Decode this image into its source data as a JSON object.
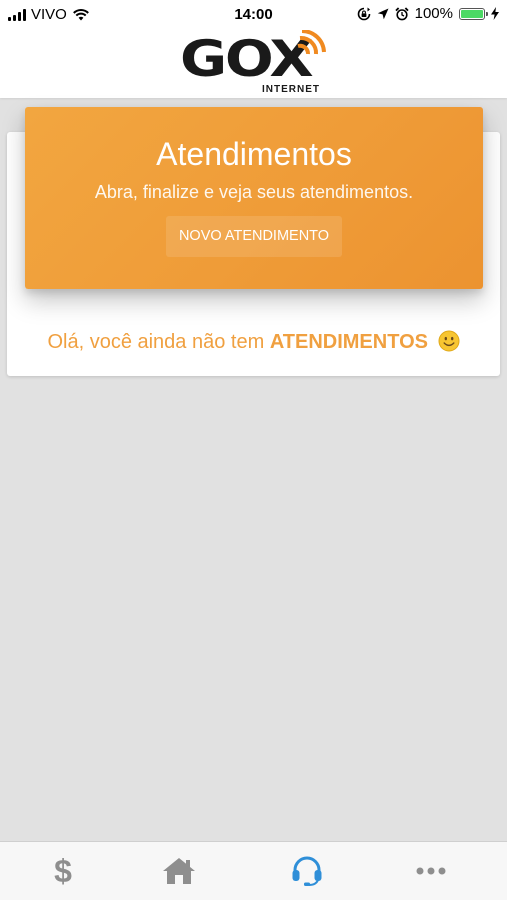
{
  "status_bar": {
    "carrier": "VIVO",
    "time": "14:00",
    "battery": "100%",
    "battery_level": 1.0,
    "icons": [
      "signal-icon",
      "wifi-icon",
      "rotation-lock-icon",
      "location-icon",
      "alarm-icon",
      "battery-icon",
      "charging-icon"
    ]
  },
  "header": {
    "logo_text": "GOX",
    "logo_subtext": "INTERNET"
  },
  "hero": {
    "title": "Atendimentos",
    "subtitle": "Abra, finalize e veja seus atendimentos.",
    "button_label": "NOVO ATENDIMENTO"
  },
  "empty_state": {
    "message": "Olá, você ainda não tem",
    "highlight": "ATENDIMENTOS",
    "emoji": "smiley-icon"
  },
  "tabbar": {
    "tabs": [
      {
        "icon": "dollar-icon",
        "label": "$",
        "active": false
      },
      {
        "icon": "home-icon",
        "active": false
      },
      {
        "icon": "headset-icon",
        "active": true
      },
      {
        "icon": "more-icon",
        "active": false
      }
    ]
  },
  "colors": {
    "accent": "#f0a040",
    "hero_gradient_start": "#f2a640",
    "hero_gradient_end": "#ec9330",
    "tab_active": "#2f8fd8",
    "tab_inactive": "#8e8e8e",
    "background": "#e1e1e1"
  }
}
